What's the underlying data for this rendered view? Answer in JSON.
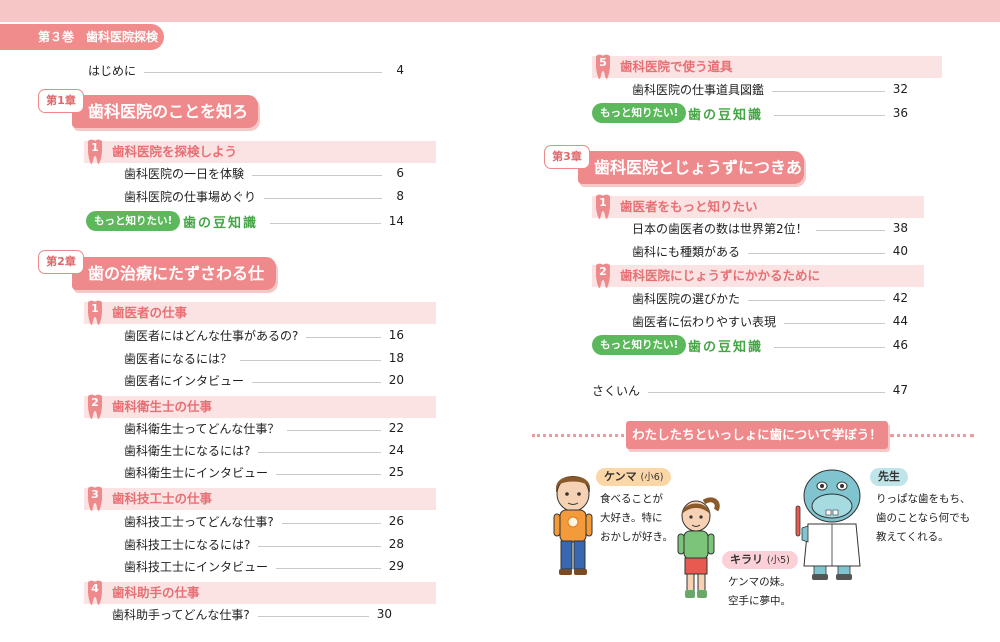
{
  "header": {
    "volume_label": "第３巻　歯科医院探検"
  },
  "left": {
    "intro": {
      "title": "はじめに",
      "page": "4"
    },
    "ch1": {
      "tag": "第1章",
      "title": "歯科医院のことを知ろう",
      "sec1": {
        "num": "1",
        "title": "歯科医院を探検しよう",
        "items": [
          {
            "title": "歯科医院の一日を体験",
            "page": "6"
          },
          {
            "title": "歯科医院の仕事場めぐり",
            "page": "8"
          }
        ]
      },
      "more": {
        "badge": "もっと知りたい!",
        "label": "歯の豆知識",
        "page": "14"
      }
    },
    "ch2": {
      "tag": "第2章",
      "title": "歯の治療にたずさわる仕事",
      "sec1": {
        "num": "1",
        "title": "歯医者の仕事",
        "items": [
          {
            "title": "歯医者にはどんな仕事があるの?",
            "page": "16"
          },
          {
            "title": "歯医者になるには？",
            "page": "18"
          },
          {
            "title": "歯医者にインタビュー",
            "page": "20"
          }
        ]
      },
      "sec2": {
        "num": "2",
        "title": "歯科衛生士の仕事",
        "items": [
          {
            "title": "歯科衛生士ってどんな仕事？",
            "page": "22"
          },
          {
            "title": "歯科衛生士になるには?",
            "page": "24"
          },
          {
            "title": "歯科衛生士にインタビュー",
            "page": "25"
          }
        ]
      },
      "sec3": {
        "num": "3",
        "title": "歯科技工士の仕事",
        "items": [
          {
            "title": "歯科技工士ってどんな仕事?",
            "page": "26"
          },
          {
            "title": "歯科技工士になるには?",
            "page": "28"
          },
          {
            "title": "歯科技工士にインタビュー",
            "page": "29"
          }
        ]
      },
      "sec4": {
        "num": "4",
        "title": "歯科助手の仕事",
        "items": [
          {
            "title": "歯科助手ってどんな仕事?",
            "page": "30"
          }
        ]
      }
    }
  },
  "right": {
    "sec5": {
      "num": "5",
      "title": "歯科医院で使う道具",
      "items": [
        {
          "title": "歯科医院の仕事道具図鑑",
          "page": "32"
        }
      ]
    },
    "more1": {
      "badge": "もっと知りたい!",
      "label": "歯の豆知識",
      "page": "36"
    },
    "ch3": {
      "tag": "第3章",
      "title": "歯科医院とじょうずにつきあう",
      "sec1": {
        "num": "1",
        "title": "歯医者をもっと知りたい",
        "items": [
          {
            "title": "日本の歯医者の数は世界第2位！",
            "page": "38"
          },
          {
            "title": "歯科にも種類がある",
            "page": "40"
          }
        ]
      },
      "sec2": {
        "num": "2",
        "title": "歯科医院にじょうずにかかるために",
        "items": [
          {
            "title": "歯科医院の選びかた",
            "page": "42"
          },
          {
            "title": "歯医者に伝わりやすい表現",
            "page": "44"
          }
        ]
      },
      "more": {
        "badge": "もっと知りたい!",
        "label": "歯の豆知識",
        "page": "46"
      }
    },
    "index": {
      "title": "さくいん",
      "page": "47"
    },
    "banner": "わたしたちといっしょに歯について学ぼう！",
    "characters": {
      "kenma": {
        "name": "ケンマ",
        "grade": "(小6)",
        "lines": [
          "食べることが",
          "大好き。特に",
          "おかしが好き。"
        ]
      },
      "kirari": {
        "name": "キラリ",
        "grade": "(小5)",
        "lines": [
          "ケンマの妹。",
          "空手に夢中。"
        ]
      },
      "sensei": {
        "name": "先生",
        "lines": [
          "りっぱな歯をもち、",
          "歯のことなら何でも",
          "教えてくれる。"
        ]
      }
    }
  },
  "colors": {
    "accent_pink": "#ef8a8c",
    "section_bg": "#fbe3e3",
    "green": "#5bb85b"
  }
}
